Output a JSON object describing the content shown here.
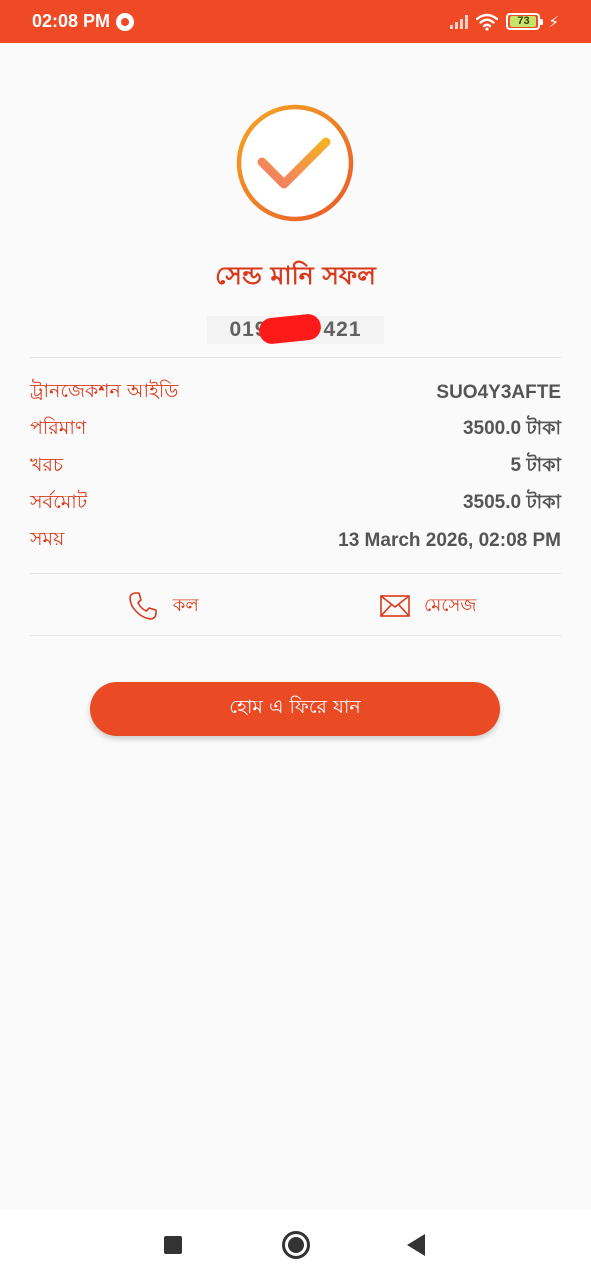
{
  "status_bar": {
    "time": "02:08 PM",
    "battery": "73",
    "notification_icon": "app-notification-icon",
    "charging_icon": "lightning-icon"
  },
  "colors": {
    "primary": "#ef4a25",
    "title": "#d9391b",
    "check_gradient_start": "#f6a623",
    "check_gradient_end": "#ee4d2d"
  },
  "success": {
    "icon": "checkmark-circle-icon",
    "title": "সেন্ড মানি সফল",
    "recipient_number_start": "019",
    "recipient_number_end": "421"
  },
  "details": [
    {
      "label": "ট্রানজেকশন আইডি",
      "value": "SUO4Y3AFTE"
    },
    {
      "label": "পরিমাণ",
      "value": "3500.0 টাকা"
    },
    {
      "label": "খরচ",
      "value": "5 টাকা"
    },
    {
      "label": "সর্বমোট",
      "value": "3505.0 টাকা"
    },
    {
      "label": "সময়",
      "value": "13 March 2026, 02:08 PM"
    }
  ],
  "actions": {
    "call_label": "কল",
    "call_icon": "phone-icon",
    "message_label": "মেসেজ",
    "message_icon": "envelope-icon"
  },
  "home_button": "হোম এ ফিরে যান",
  "nav": {
    "recent_icon": "square-icon",
    "home_icon": "circle-icon",
    "back_icon": "triangle-back-icon"
  }
}
